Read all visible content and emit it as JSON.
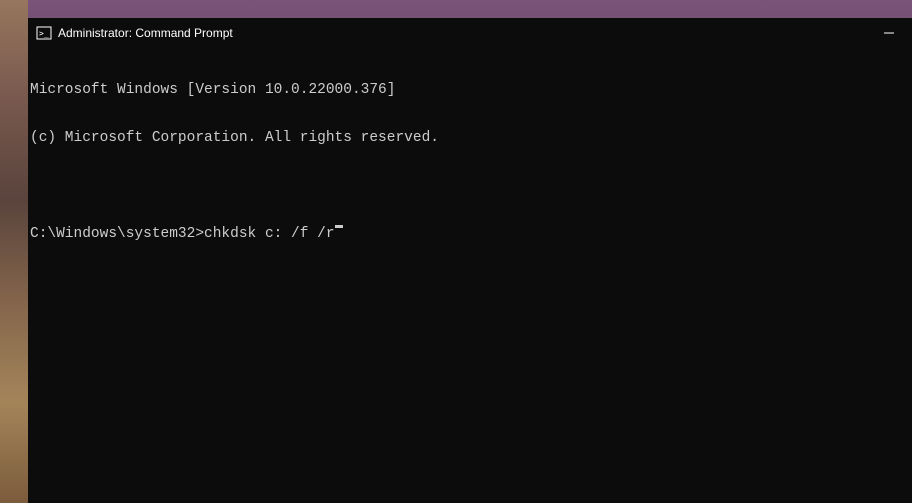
{
  "window": {
    "title": "Administrator: Command Prompt"
  },
  "terminal": {
    "line1": "Microsoft Windows [Version 10.0.22000.376]",
    "line2": "(c) Microsoft Corporation. All rights reserved.",
    "prompt": "C:\\Windows\\system32>",
    "command": "chkdsk c: /f /r"
  }
}
